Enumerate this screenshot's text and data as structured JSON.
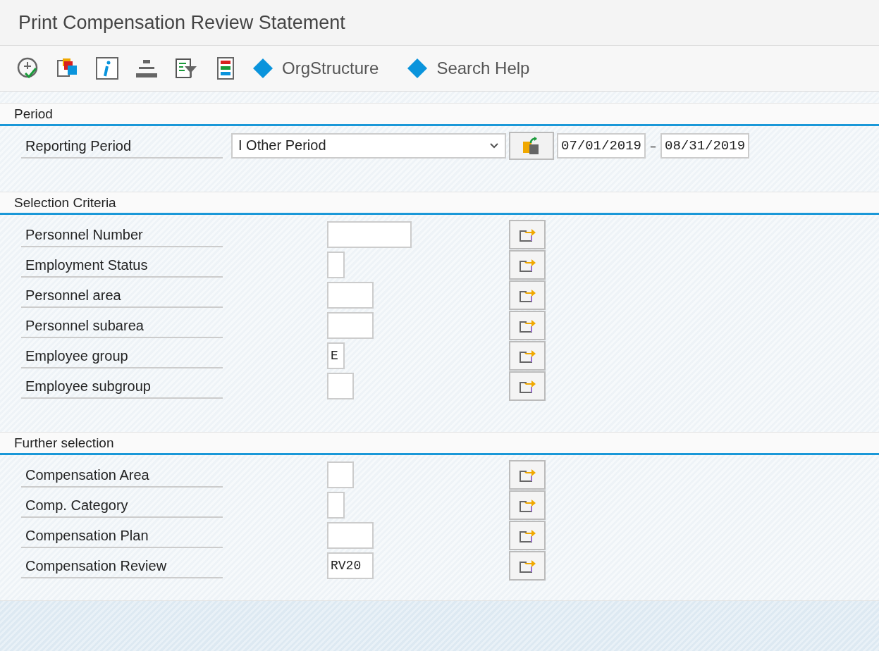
{
  "window": {
    "title": "Print Compensation Review Statement"
  },
  "toolbar": [
    {
      "kind": "execute"
    },
    {
      "kind": "copy"
    },
    {
      "kind": "info"
    },
    {
      "kind": "stack"
    },
    {
      "kind": "filter"
    },
    {
      "kind": "list"
    },
    {
      "kind": "link",
      "label": "OrgStructure"
    },
    {
      "kind": "link",
      "label": "Search Help"
    }
  ],
  "period": {
    "heading": "Period",
    "label": "Reporting Period",
    "dropdown": "I Other Period",
    "from": "07/01/2019",
    "separator": "–",
    "to": "08/31/2019"
  },
  "sections": [
    {
      "heading": "Selection Criteria",
      "fields": [
        {
          "label": "Personnel Number",
          "kind": "long"
        },
        {
          "label": "Employment Status",
          "kind": "tiny"
        },
        {
          "label": "Personnel area",
          "kind": "medium"
        },
        {
          "label": "Personnel subarea",
          "kind": "medium"
        },
        {
          "label": "Employee group",
          "kind": "tiny",
          "value": "E"
        },
        {
          "label": "Employee subgroup",
          "kind": "short"
        }
      ]
    },
    {
      "heading": "Further selection",
      "fields": [
        {
          "label": "Compensation Area",
          "kind": "short"
        },
        {
          "label": "Comp. Category",
          "kind": "tiny"
        },
        {
          "label": "Compensation Plan",
          "kind": "medium"
        },
        {
          "label": "Compensation Review",
          "kind": "medium",
          "value": "RV20"
        }
      ]
    }
  ]
}
